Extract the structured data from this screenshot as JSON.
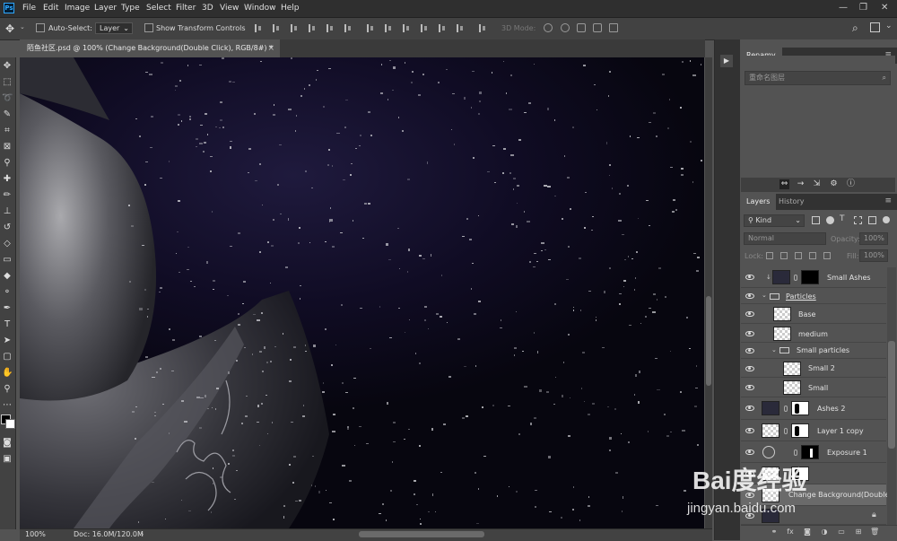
{
  "app": {
    "logo_text": "Ps"
  },
  "menu": [
    "File",
    "Edit",
    "Image",
    "Layer",
    "Type",
    "Select",
    "Filter",
    "3D",
    "View",
    "Window",
    "Help"
  ],
  "window_controls": {
    "minimize": "—",
    "restore": "❐",
    "close": "✕"
  },
  "options_bar": {
    "auto_select_label": "Auto-Select:",
    "auto_select_target": "Layer",
    "show_transform_label": "Show Transform Controls",
    "mode_3d_label": "3D Mode:"
  },
  "document": {
    "tab_title": "陌鱼社区.psd @ 100% (Change Background(Double Click), RGB/8#) *",
    "tab_close": "×",
    "zoom": "100%",
    "doc_info": "Doc: 16.0M/120.0M"
  },
  "renamy_panel": {
    "title": "Renamy",
    "search_placeholder": "重命名图层"
  },
  "layers_panel": {
    "tabs": [
      "Layers",
      "History"
    ],
    "filter_kind": "Kind",
    "blend_mode": "Normal",
    "opacity_label": "Opacity:",
    "opacity_value": "100%",
    "lock_label": "Lock:",
    "fill_label": "Fill:",
    "fill_value": "100%",
    "layers": [
      {
        "name": "Small Ashes"
      },
      {
        "name": "Particles"
      },
      {
        "name": "Base"
      },
      {
        "name": "medium"
      },
      {
        "name": "Small particles"
      },
      {
        "name": "Small 2"
      },
      {
        "name": "Small"
      },
      {
        "name": "Ashes 2"
      },
      {
        "name": "Layer 1 copy"
      },
      {
        "name": "Exposure 1"
      },
      {
        "name": "Change Background(Double..."
      }
    ],
    "footer_icons": [
      "link-icon",
      "fx-icon",
      "mask-icon",
      "adjustment-icon",
      "group-icon",
      "new-layer-icon",
      "trash-icon"
    ]
  },
  "watermark": {
    "logo": "Bai度经验",
    "url": "jingyan.baidu.com"
  }
}
